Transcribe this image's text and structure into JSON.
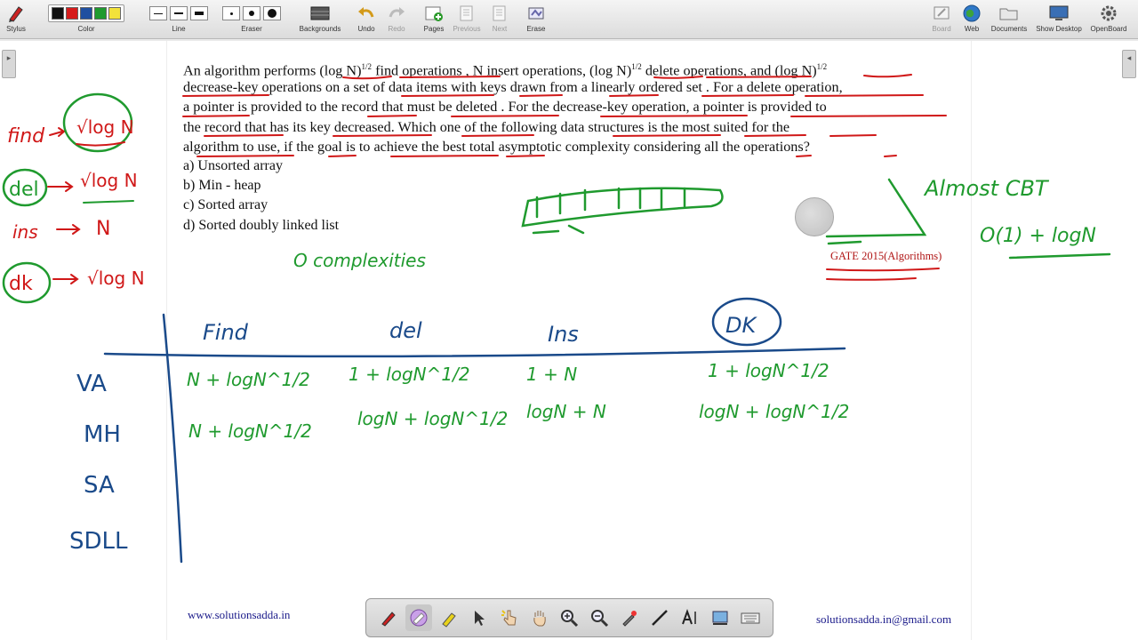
{
  "toolbar": {
    "stylus": "Stylus",
    "color": "Color",
    "line": "Line",
    "eraser": "Eraser",
    "backgrounds": "Backgrounds",
    "undo": "Undo",
    "redo": "Redo",
    "pages": "Pages",
    "previous": "Previous",
    "next": "Next",
    "erase": "Erase",
    "board": "Board",
    "web": "Web",
    "documents": "Documents",
    "show_desktop": "Show Desktop",
    "openboard": "OpenBoard",
    "colors": [
      "#111111",
      "#d61c1c",
      "#1f4fa0",
      "#1f9a2e",
      "#f2e23a"
    ]
  },
  "question": {
    "line1_a": "An algorithm performs",
    "logN": "(log N)",
    "half": "1/2",
    "line1_b": "find operations , N insert operations,",
    "line1_c": "delete operations, and",
    "line2": "decrease-key operations on a set of data items with keys drawn from a linearly ordered set . For a delete operation,",
    "line3": "a pointer is provided to the record that must be deleted . For the decrease-key operation, a pointer is provided to",
    "line4": "the record that has its key decreased. Which one of the following data structures is the most suited for the",
    "line5": "algorithm to use, if the goal is to achieve the best total asymptotic complexity considering all the operations?"
  },
  "options": [
    "a) Unsorted array",
    "b) Min - heap",
    "c) Sorted array",
    "d) Sorted doubly linked list"
  ],
  "source_label": "GATE 2015(Algorithms)",
  "footer": {
    "website": "www.solutionsadda.in",
    "email": "solutionsadda.in@gmail.com"
  },
  "handwriting": {
    "find": "find",
    "sqrt_logN": "√log N",
    "del": "del",
    "ins": "ins",
    "N": "N",
    "dk": "dk",
    "o_complexities": "O complexities",
    "almost_cbt": "Almost CBT",
    "o1_logN": "O(1) + logN",
    "col_find": "Find",
    "col_del": "del",
    "col_ins": "Ins",
    "col_dk": "DK",
    "row_va": "VA",
    "row_mh": "MH",
    "row_sa": "SA",
    "row_sdll": "SDLL",
    "va_find": "N + logN^1/2",
    "va_del": "1 + logN^1/2",
    "va_ins": "1 + N",
    "va_dk": "1 + logN^1/2",
    "mh_find": "N + logN^1/2",
    "mh_del": "logN + logN^1/2",
    "mh_ins": "logN + N",
    "mh_dk": "logN + logN^1/2"
  }
}
